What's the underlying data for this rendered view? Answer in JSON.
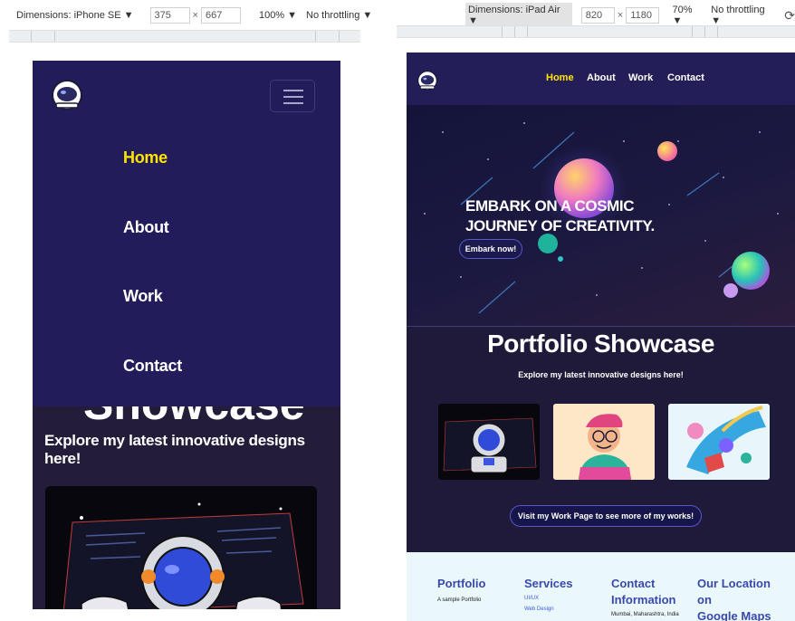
{
  "devtools_left": {
    "dimensions_label": "Dimensions: iPhone SE",
    "width": "375",
    "times": "×",
    "height": "667",
    "zoom": "100%",
    "throttling": "No throttling"
  },
  "devtools_right": {
    "dimensions_label": "Dimensions: iPad Air",
    "width": "820",
    "times": "×",
    "height": "1180",
    "zoom": "70%",
    "throttling": "No throttling"
  },
  "mobile": {
    "menu": [
      {
        "label": "Home",
        "active": true
      },
      {
        "label": "About",
        "active": false
      },
      {
        "label": "Work",
        "active": false
      },
      {
        "label": "Contact",
        "active": false
      }
    ],
    "showcase_partial": "Showcase",
    "subtitle": "Explore my latest innovative designs here!"
  },
  "tablet": {
    "nav": [
      {
        "label": "Home",
        "active": true
      },
      {
        "label": "About",
        "active": false
      },
      {
        "label": "Work",
        "active": false
      },
      {
        "label": "Contact",
        "active": false
      }
    ],
    "hero": {
      "line1": "EMBARK ON A COSMIC",
      "line2": "JOURNEY OF CREATIVITY.",
      "button": "Embark now!"
    },
    "showcase_title": "Portfolio Showcase",
    "showcase_subtitle": "Explore my latest innovative designs here!",
    "visit_button": "Visit my Work Page to see more of my works!",
    "footer": {
      "col1_heading": "Portfolio",
      "col1_text": "A sample Portfolio",
      "col2_heading": "Services",
      "col2_links": [
        "UI/UX",
        "Web Design"
      ],
      "col3_heading_line1": "Contact",
      "col3_heading_line2": "Information",
      "col3_text": "Mumbai, Maharashtra, India",
      "col4_heading_line1": "Our Location",
      "col4_heading_line2": "on",
      "col4_heading_line3": "Google Maps"
    }
  },
  "colors": {
    "nav_bg": "#221c5a",
    "page_bg": "#231d3a",
    "accent_yellow": "#ffe600",
    "footer_heading": "#3949ab"
  },
  "icons": [
    "astronaut-helmet-logo-icon",
    "hamburger-menu-icon",
    "rotate-device-icon"
  ]
}
